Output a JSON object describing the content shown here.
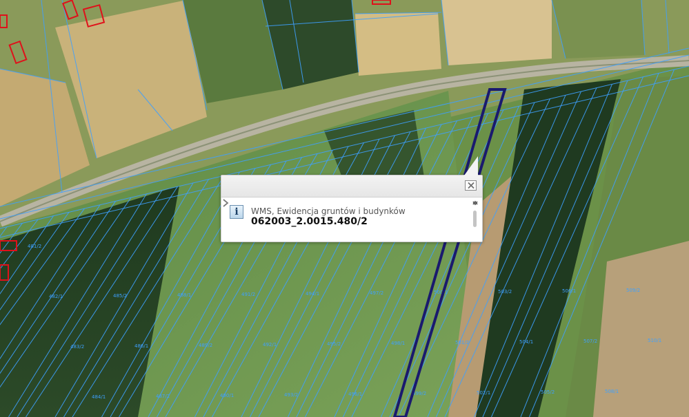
{
  "popup": {
    "source": "WMS, Ewidencja gruntów i budynków",
    "parcel_id": "062003_2.0015.480/2",
    "icon": "info-icon",
    "close_icon": "close-icon",
    "next_icon": "chevron-right-icon"
  },
  "map": {
    "layer": "WMS, Ewidencja gruntów i budynków",
    "colors": {
      "parcel_line": "#3ea0ff",
      "selected_parcel": "#1a1a6e",
      "building_outline": "#e0101a"
    },
    "parcel_labels": [
      "481/2",
      "482/1",
      "483/2",
      "484/1",
      "485/2",
      "486/1",
      "487/2",
      "488/1",
      "489/2",
      "490/1",
      "491/2",
      "492/1",
      "493/2",
      "494/1",
      "495/2",
      "496/1",
      "497/2",
      "498/1",
      "499/2",
      "500/1",
      "501/2",
      "502/1",
      "503/2",
      "504/1",
      "505/2",
      "506/1",
      "507/2",
      "508/1",
      "509/2",
      "510/1"
    ]
  }
}
